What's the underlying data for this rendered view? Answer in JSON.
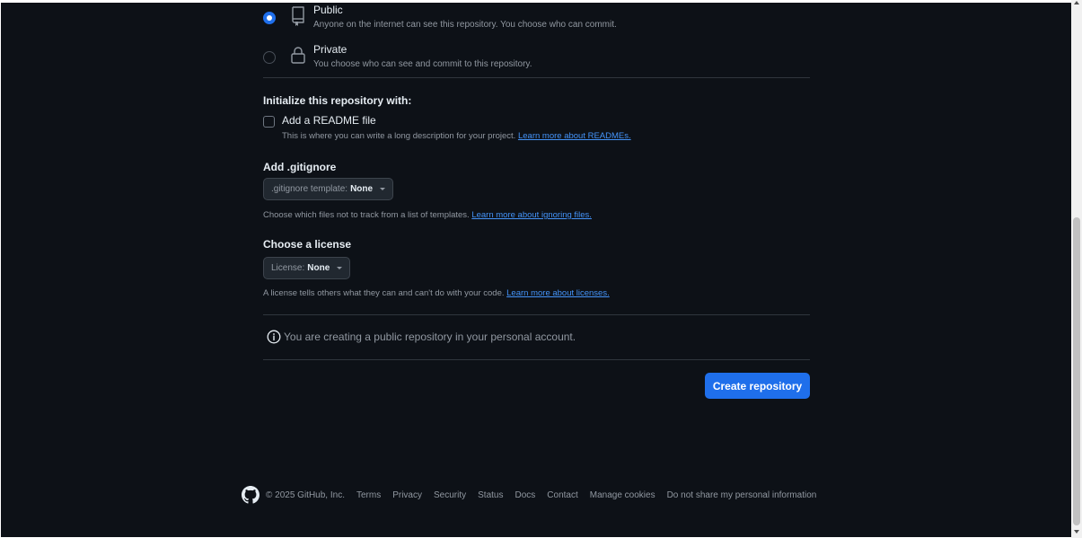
{
  "visibility": {
    "public": {
      "title": "Public",
      "description": "Anyone on the internet can see this repository. You choose who can commit.",
      "icon": "repo-icon",
      "selected": true
    },
    "private": {
      "title": "Private",
      "description": "You choose who can see and commit to this repository.",
      "icon": "lock-icon",
      "selected": false
    }
  },
  "initialize": {
    "heading": "Initialize this repository with:",
    "readme_label": "Add a README file",
    "readme_checked": false,
    "readme_help": "This is where you can write a long description for your project.",
    "readme_link": "Learn more about READMEs."
  },
  "gitignore": {
    "heading": "Add .gitignore",
    "select_label": ".gitignore template:",
    "select_value": "None",
    "help": "Choose which files not to track from a list of templates.",
    "link": "Learn more about ignoring files."
  },
  "license": {
    "heading": "Choose a license",
    "select_label": "License:",
    "select_value": "None",
    "help": "A license tells others what they can and can't do with your code.",
    "link": "Learn more about licenses."
  },
  "notice": {
    "icon": "info-icon",
    "text": "You are creating a public repository in your personal account."
  },
  "create_button": "Create repository",
  "footer": {
    "logo": "github-logo-icon",
    "copyright": "© 2025 GitHub, Inc.",
    "links": [
      "Terms",
      "Privacy",
      "Security",
      "Status",
      "Docs",
      "Contact",
      "Manage cookies",
      "Do not share my personal information"
    ]
  },
  "colors": {
    "background": "#0d1117",
    "accent": "#1f6feb",
    "link": "#4493f8",
    "muted_text": "#9198a1",
    "text": "#e6edf3",
    "border": "#30363d"
  }
}
